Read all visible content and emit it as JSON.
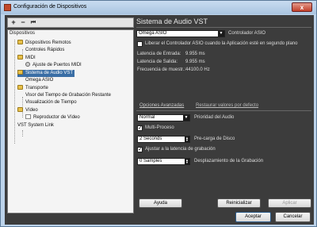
{
  "window": {
    "title": "Configuración de Dispositivos",
    "close_glyph": "x"
  },
  "toolbar": {
    "add_glyph": "+",
    "remove_glyph": "−",
    "reset_glyph": "⏮"
  },
  "tree": {
    "header": "Dispositivos",
    "items": [
      {
        "label": "Dispositivos Remotos",
        "icon": "folder-icon"
      },
      {
        "label": "Controles Rápidos",
        "icon": "device-icon"
      },
      {
        "label": "MIDI",
        "icon": "folder-icon"
      },
      {
        "label": "Ajuste de Puertos MIDI",
        "icon": "gear-icon"
      },
      {
        "label": "Sistema de Audio VST",
        "icon": "audio-icon",
        "selected": true
      },
      {
        "label": "Omega ASIO",
        "icon": "device-icon"
      },
      {
        "label": "Transporte",
        "icon": "folder-icon"
      },
      {
        "label": "Visor del Tiempo de Grabación Restante",
        "icon": "device-icon"
      },
      {
        "label": "Visualización de Tiempo",
        "icon": "device-icon"
      },
      {
        "label": "Vídeo",
        "icon": "folder-icon"
      },
      {
        "label": "Reproductor de Vídeo",
        "icon": "video-icon"
      },
      {
        "label": "VST System Link",
        "icon": "device-icon"
      }
    ]
  },
  "panel": {
    "title": "Sistema de Audio VST",
    "driver": {
      "value": "Omega ASIO",
      "label": "Controlador ASIO"
    },
    "release_driver": {
      "label": "Liberar el Controlador ASIO cuando la Aplicación esté en segundo plano",
      "checked": false
    },
    "input_latency": {
      "label": "Latencia de Entrada:",
      "value": "9.955 ms"
    },
    "output_latency": {
      "label": "Latencia de Salida:",
      "value": "9.955 ms"
    },
    "sample_rate": {
      "label": "Frecuencia de muestr.:",
      "value": "44100.0 Hz"
    },
    "advanced": {
      "label": "Opciones Avanzadas",
      "restore": "Restaurar valores por defecto"
    },
    "priority": {
      "value": "Normal",
      "label": "Prioridad del Audio"
    },
    "multiprocess": {
      "label": "Multi-Proceso",
      "checked": true
    },
    "preload": {
      "value": "2 Seconds",
      "label": "Pre-carga de Disco"
    },
    "adjust_latency": {
      "label": "Ajustar a la latencia de grabación",
      "checked": true
    },
    "offset": {
      "value": "0 Samples",
      "label": "Desplazamiento de la Grabación"
    }
  },
  "buttons": {
    "help": "Ayuda",
    "reset": "Reinicializar",
    "apply": "Aplicar",
    "accept": "Aceptar",
    "cancel": "Cancelar"
  }
}
